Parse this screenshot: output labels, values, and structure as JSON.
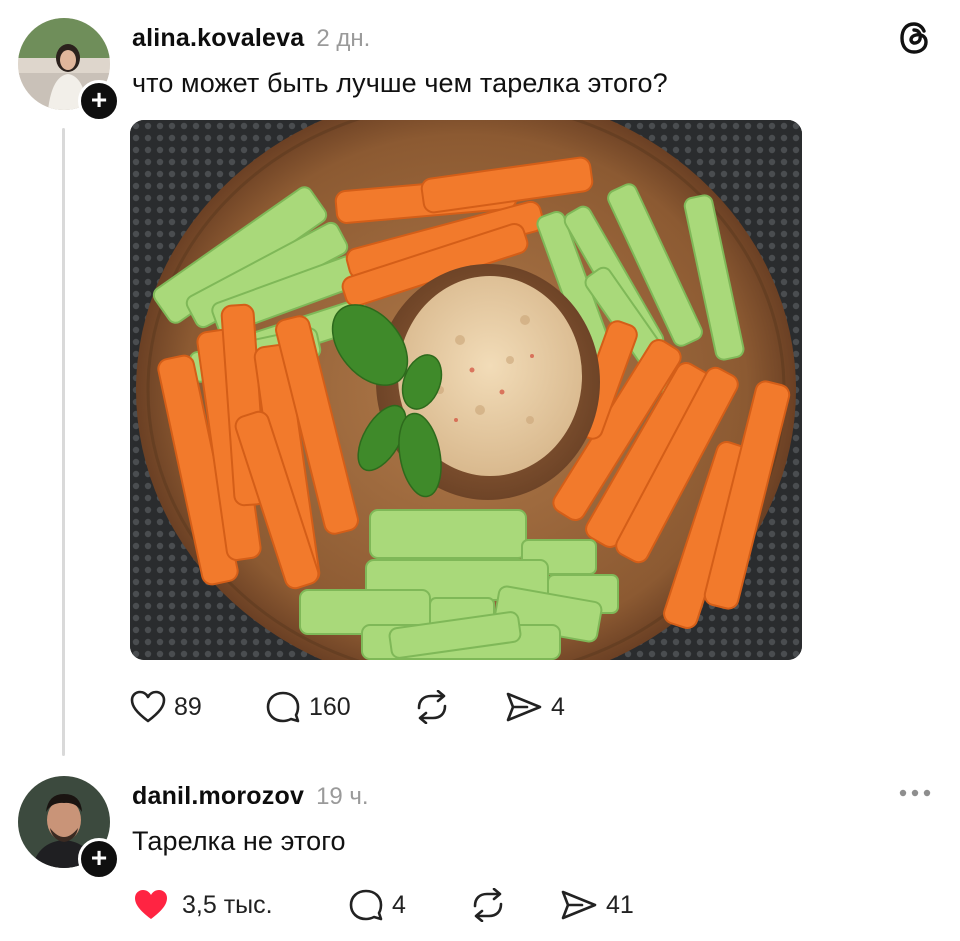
{
  "post": {
    "username": "alina.kovaleva",
    "time": "2 дн.",
    "text": "что может быть лучше чем тарелка этого?",
    "actions": {
      "likes": "89",
      "comments": "160",
      "shares": "4"
    }
  },
  "reply": {
    "username": "danil.morozov",
    "time": "19 ч.",
    "text": "Тарелка не этого",
    "actions": {
      "likes": "3,5 тыс.",
      "comments": "4",
      "shares": "41"
    }
  },
  "icons": {
    "app_logo": "threads-logo-icon",
    "like": "heart-icon",
    "like_active": "heart-filled-icon",
    "comment": "comment-bubble-icon",
    "repost": "repost-icon",
    "share": "send-icon",
    "more": "more-dots-icon",
    "follow": "plus-icon"
  },
  "colors": {
    "heart_active": "#ff2442",
    "muted_text": "#9a9a9a",
    "thread_line": "#d9d9d9"
  }
}
